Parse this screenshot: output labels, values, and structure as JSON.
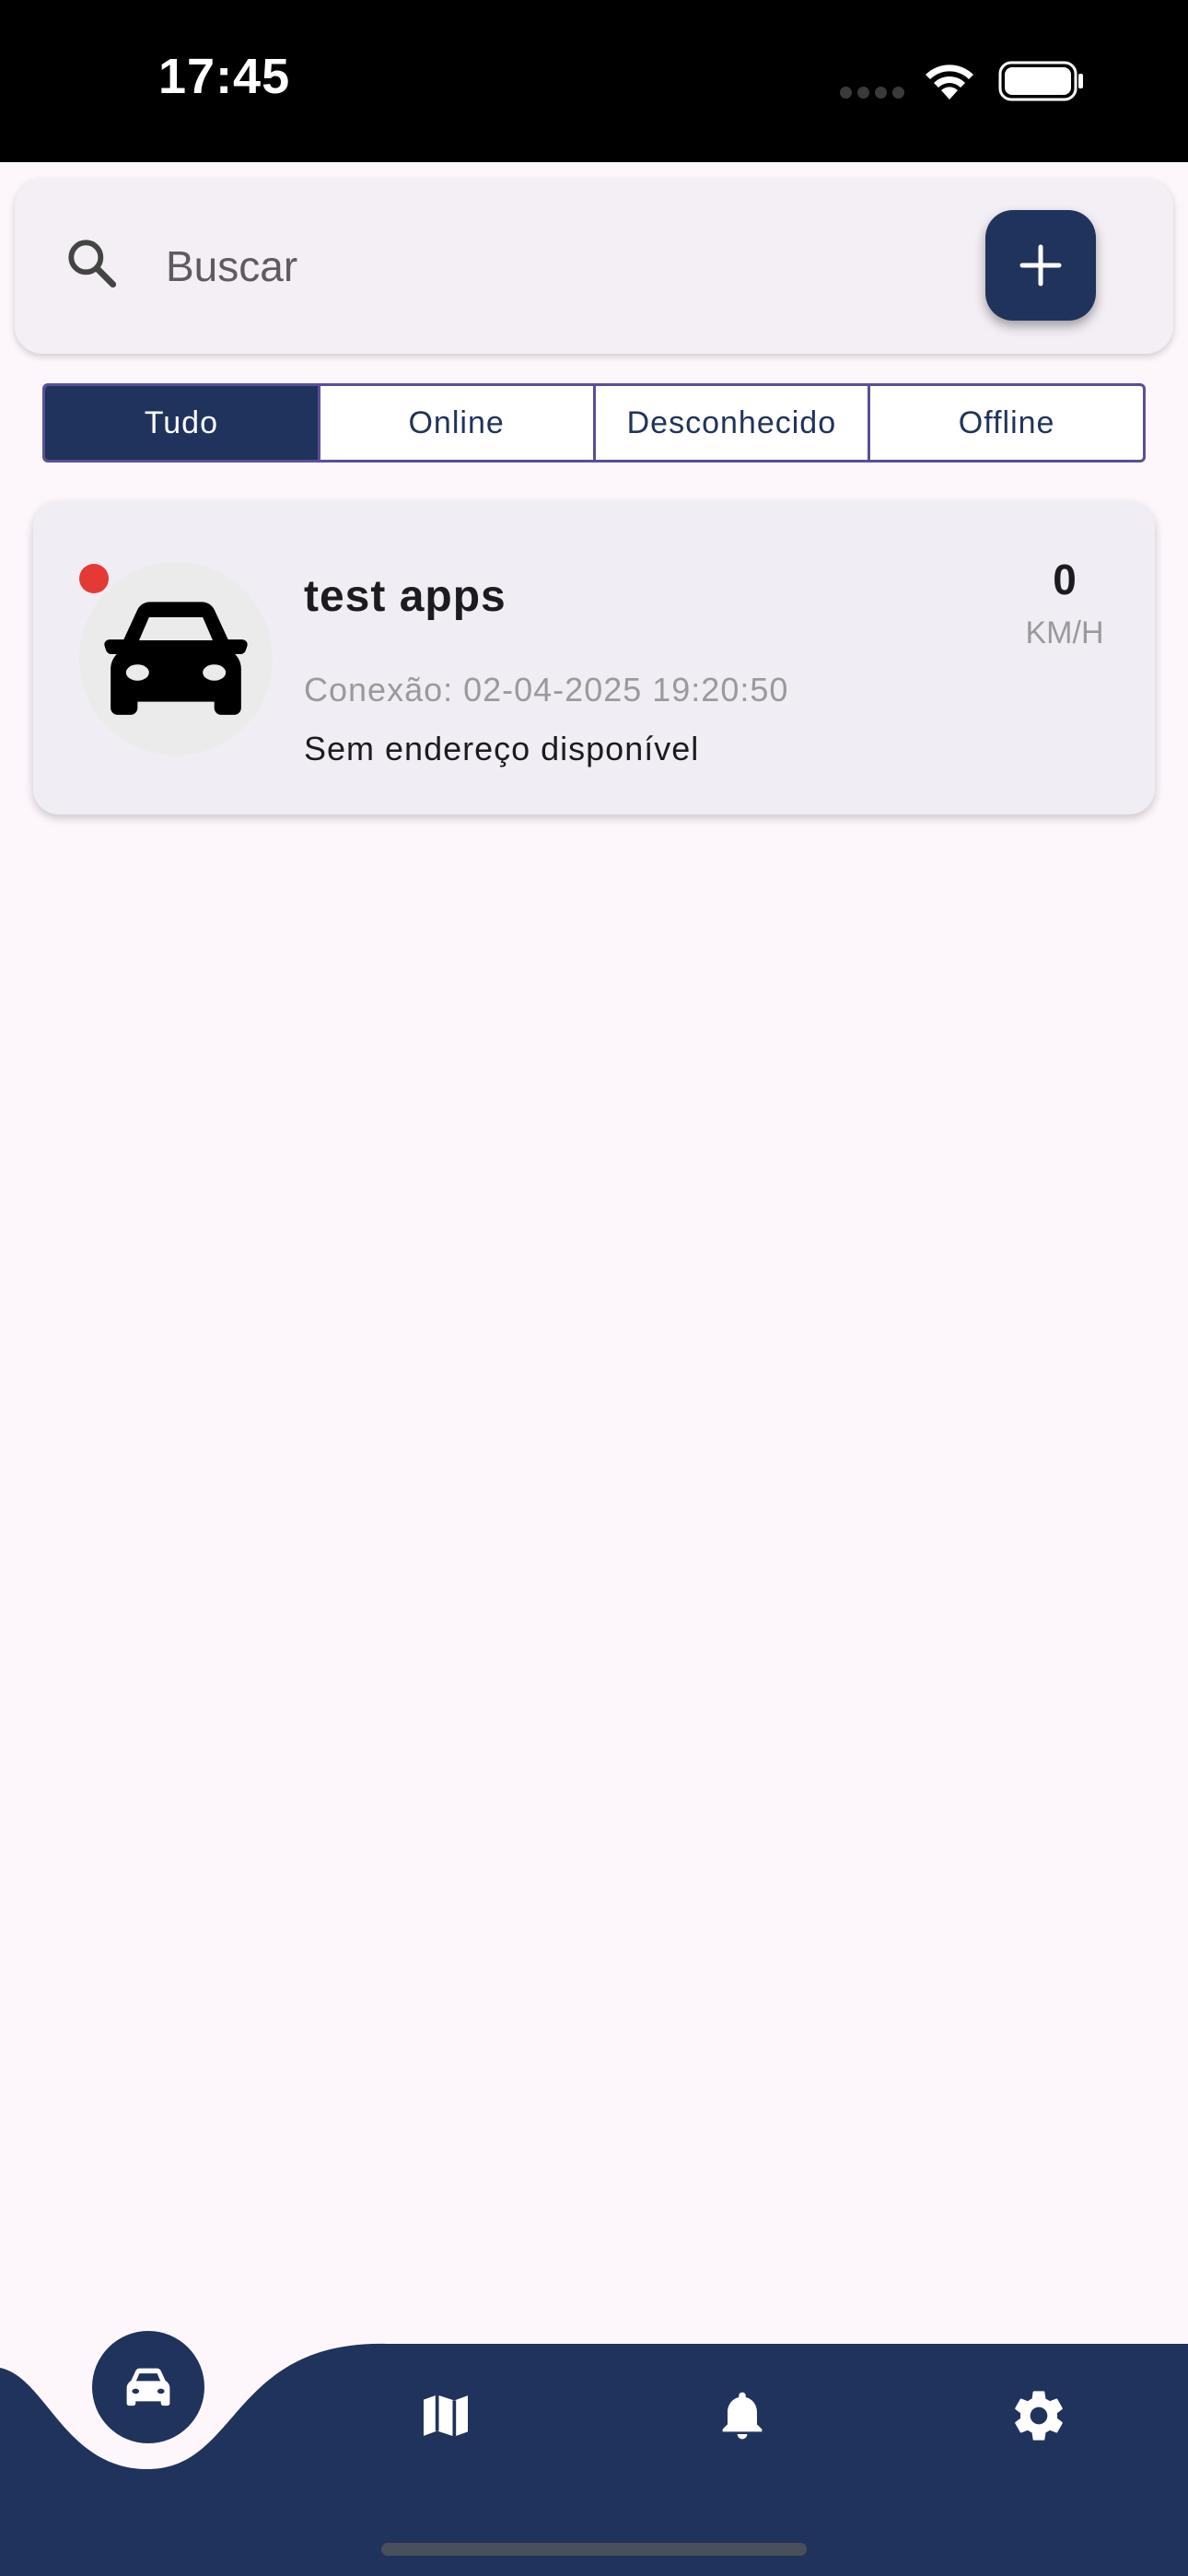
{
  "status_bar": {
    "time": "17:45",
    "icons": [
      "signal-dots-icon",
      "wifi-icon",
      "battery-icon"
    ]
  },
  "search": {
    "placeholder": "Buscar",
    "icon": "search-icon",
    "add_button_icon": "plus-icon"
  },
  "filters": {
    "tabs": [
      {
        "label": "Tudo",
        "active": true
      },
      {
        "label": "Online",
        "active": false
      },
      {
        "label": "Desconhecido",
        "active": false
      },
      {
        "label": "Offline",
        "active": false
      }
    ]
  },
  "vehicles": [
    {
      "name": "test apps",
      "connection": "Conexão: 02-04-2025 19:20:50",
      "address": "Sem endereço disponível",
      "speed": "0",
      "speed_unit": "KM/H",
      "status_color": "#e53935",
      "icon": "car-icon"
    }
  ],
  "bottom_nav": {
    "items": [
      "car-icon",
      "map-icon",
      "bell-icon",
      "gear-icon"
    ],
    "active_index": 0
  },
  "colors": {
    "primary": "#20335c",
    "background": "#fdf7fc",
    "card": "#f1edf4",
    "offline_dot": "#e53935",
    "segment_border": "#5a4f96"
  }
}
